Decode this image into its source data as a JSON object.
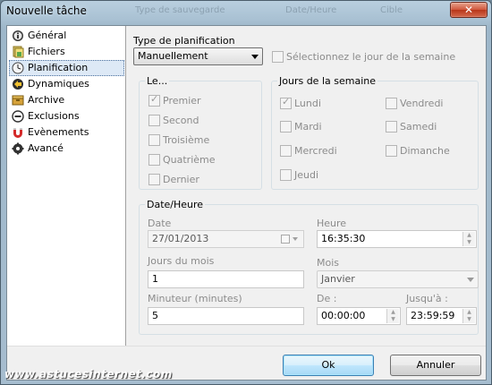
{
  "window": {
    "title": "Nouvelle tâche",
    "close_glyph": "✕",
    "ghost_labels": [
      "Type de sauvegarde",
      "Date/Heure",
      "Cible"
    ]
  },
  "nav": {
    "items": [
      {
        "label": "Général",
        "icon": "info-icon"
      },
      {
        "label": "Fichiers",
        "icon": "files-icon"
      },
      {
        "label": "Planification",
        "icon": "clock-icon",
        "selected": true
      },
      {
        "label": "Dynamiques",
        "icon": "dynamics-icon"
      },
      {
        "label": "Archive",
        "icon": "archive-icon"
      },
      {
        "label": "Exclusions",
        "icon": "exclusion-icon"
      },
      {
        "label": "Evènements",
        "icon": "magnet-icon"
      },
      {
        "label": "Avancé",
        "icon": "gear-icon"
      }
    ]
  },
  "schedule": {
    "type_label": "Type de planification",
    "type_value": "Manuellement",
    "select_day_label": "Sélectionnez le jour de la semaine"
  },
  "le_group": {
    "title": "Le...",
    "options": [
      "Premier",
      "Second",
      "Troisième",
      "Quatrième",
      "Dernier"
    ],
    "checked": "Premier"
  },
  "days_group": {
    "title": "Jours de la semaine",
    "left": [
      "Lundi",
      "Mardi",
      "Mercredi",
      "Jeudi"
    ],
    "right": [
      "Vendredi",
      "Samedi",
      "Dimanche"
    ],
    "checked": "Lundi"
  },
  "datetime": {
    "title": "Date/Heure",
    "date_label": "Date",
    "date_value": "27/01/2013",
    "time_label": "Heure",
    "time_value": "16:35:30",
    "days_label": "Jours du mois",
    "days_value": "1",
    "month_label": "Mois",
    "month_value": "Janvier",
    "timer_label": "Minuteur (minutes)",
    "timer_value": "5",
    "from_label": "De :",
    "from_value": "00:00:00",
    "to_label": "Jusqu'à :",
    "to_value": "23:59:59"
  },
  "buttons": {
    "ok": "Ok",
    "cancel": "Annuler"
  },
  "watermark": "www.astucesinternet.com"
}
